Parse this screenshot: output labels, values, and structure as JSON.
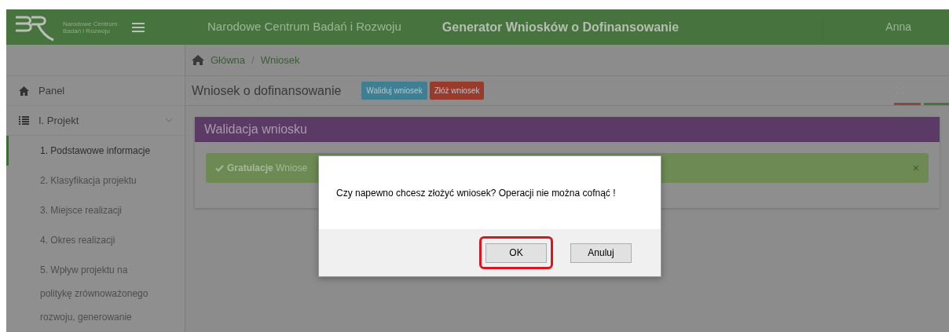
{
  "header": {
    "logo_text": "Narodowe Centrum Badań i Rozwoju",
    "org_name": "Narodowe Centrum Badań i Rozwoju",
    "app_title": "Generator Wniosków o Dofinansowanie",
    "user": "Anna"
  },
  "breadcrumb": [
    "Główna",
    "/",
    "Wniosek"
  ],
  "sidebar": {
    "items": [
      {
        "label": "Panel",
        "kind": "link"
      },
      {
        "label": "I. Projekt",
        "kind": "group",
        "expanded": true,
        "children": [
          {
            "label": "1. Podstawowe informacje",
            "selected": true
          },
          {
            "label": "2. Klasyfikacja projektu",
            "selected": false
          },
          {
            "label": "3. Miejsce realizacji",
            "selected": false
          },
          {
            "label": "4. Okres realizacji",
            "selected": false
          },
          {
            "label": "5. Wpływ projektu na politykę zrównoważonego rozwoju, generowanie",
            "selected": false
          }
        ]
      }
    ]
  },
  "page": {
    "title": "Wniosek o dofinansowanie",
    "buttons": [
      {
        "label": "Waliduj wniosek",
        "color": "#3f7f94"
      },
      {
        "label": "Złóż wniosek",
        "color": "#983a2c"
      }
    ]
  },
  "panel": {
    "title": "Walidacja wniosku",
    "alert": "**Gratulacje** Wniose",
    "close": "×"
  },
  "dialog": {
    "message": "Czy napewno chcesz złożyć wniosek? Operacji nie można cofnąć !",
    "buttons": [
      {
        "label": "OK",
        "highlighted": true
      },
      {
        "label": "Anuluj",
        "highlighted": false
      }
    ]
  }
}
